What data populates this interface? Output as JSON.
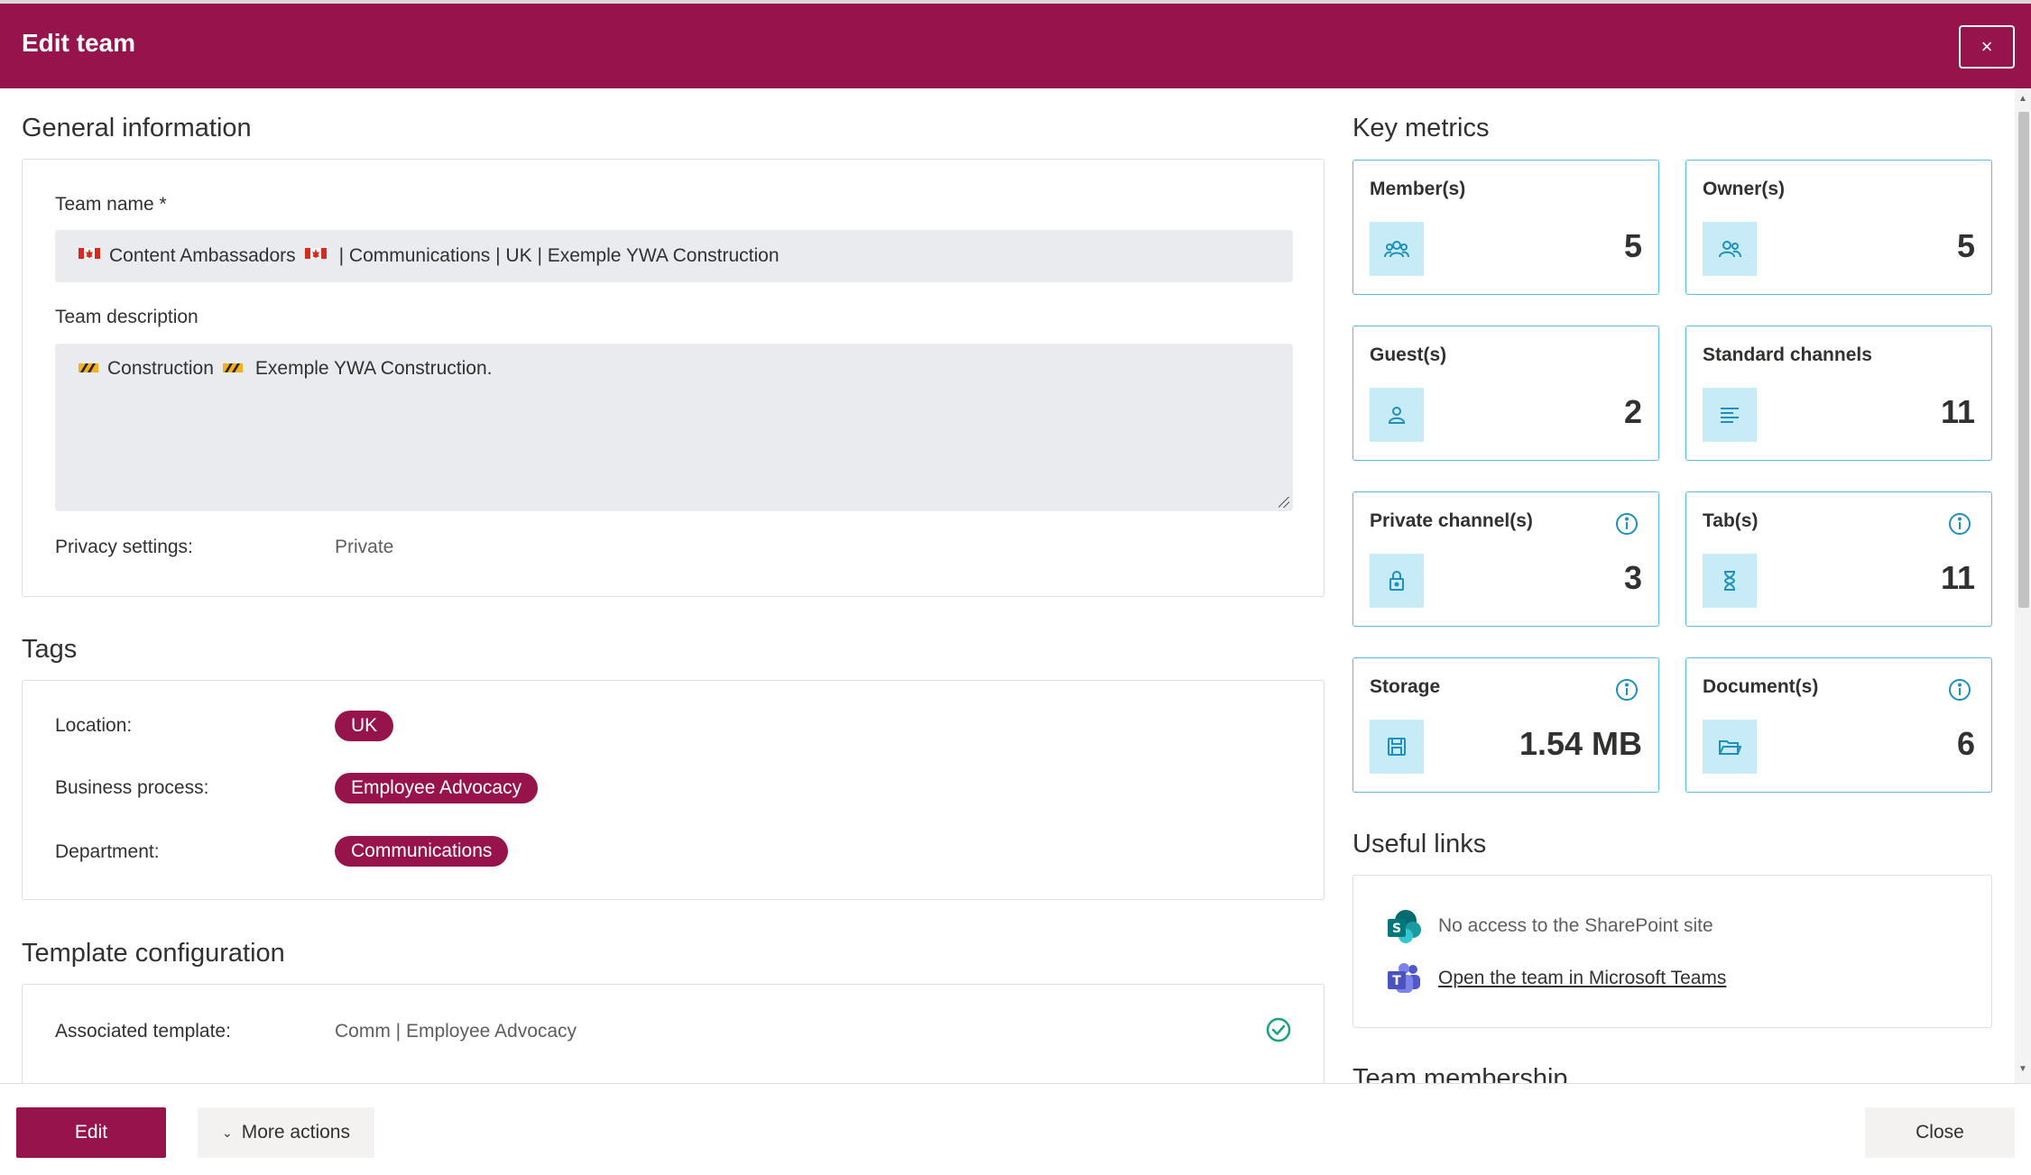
{
  "dialog": {
    "title": "Edit team",
    "close_glyph": "×"
  },
  "general": {
    "title": "General information",
    "team_name_label": "Team name *",
    "team_name_value": "Content Ambassadors",
    "team_name_suffix": "| Communications | UK | Exemple YWA Construction",
    "team_description_label": "Team description",
    "team_description_part1": "Construction",
    "team_description_part2": "Exemple YWA Construction.",
    "privacy_label": "Privacy settings:",
    "privacy_value": "Private"
  },
  "tags": {
    "title": "Tags",
    "items": [
      {
        "label": "Location:",
        "value": "UK"
      },
      {
        "label": "Business process:",
        "value": "Employee Advocacy"
      },
      {
        "label": "Department:",
        "value": "Communications"
      }
    ]
  },
  "template": {
    "title": "Template configuration",
    "associated_label": "Associated template:",
    "associated_value": "Comm | Employee Advocacy"
  },
  "metrics": {
    "title": "Key metrics",
    "items": [
      {
        "label": "Member(s)",
        "value": "5",
        "icon": "members-icon"
      },
      {
        "label": "Owner(s)",
        "value": "5",
        "icon": "owners-icon"
      },
      {
        "label": "Guest(s)",
        "value": "2",
        "icon": "guest-icon"
      },
      {
        "label": "Standard channels",
        "value": "11",
        "icon": "channels-icon"
      },
      {
        "label": "Private channel(s)",
        "value": "3",
        "icon": "lock-icon"
      },
      {
        "label": "Tab(s)",
        "value": "11",
        "icon": "hourglass-icon"
      },
      {
        "label": "Storage",
        "value": "1.54 MB",
        "icon": "save-icon"
      },
      {
        "label": "Document(s)",
        "value": "6",
        "icon": "folder-icon"
      }
    ]
  },
  "links": {
    "title": "Useful links",
    "sharepoint": "No access to the SharePoint site",
    "teams": "Open the team in Microsoft Teams"
  },
  "membership": {
    "title": "Team membership"
  },
  "footer": {
    "edit": "Edit",
    "more_actions": "More actions",
    "close": "Close"
  },
  "colors": {
    "brand": "#96134b",
    "accent": "#5bc0de",
    "icon_bg": "#c7ecf7"
  }
}
